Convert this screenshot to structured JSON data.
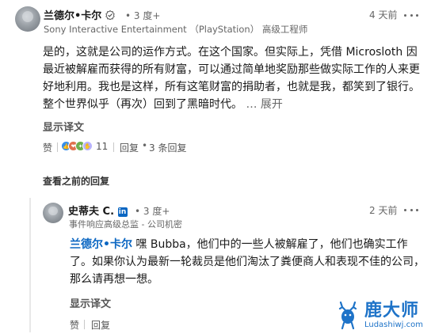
{
  "comment1": {
    "author": "兰德尔•卡尔",
    "degree": "• 3 度+",
    "headline": "Sony Interactive Entertainment （PlayStation） 高级工程师",
    "time": "4 天前",
    "text": "是的，这就是公司的运作方式。在这个国家。但实际上，凭借 Microsloth 因最近被解雇而获得的所有财富，可以通过简单地奖励那些做实际工作的人来更好地利用。我也是这样，所有这笔财富的捐助者，也就是我，都笑到了银行。整个世界似乎（再次）回到了黑暗时代。",
    "ellipsis": "…",
    "expand": "展开",
    "translate": "显示译文",
    "like": "赞",
    "reaction_count": "11",
    "reply": "回复",
    "reply_count": "3 条回复",
    "reaction_icons": [
      "like-icon",
      "love-icon",
      "celebrate-icon",
      "support-icon"
    ]
  },
  "load_previous": "查看之前的回复",
  "comment2": {
    "author": "史蒂夫 C.",
    "degree": "• 3 度+",
    "headline": "事件响应高级总监 - 公司机密",
    "time": "2 天前",
    "mention": "兰德尔•卡尔",
    "text": " 嘿 Bubba，他们中的一些人被解雇了，他们也确实工作了。如果你认为最新一轮裁员是他们淘汰了粪便商人和表现不佳的公司，那么请再想一想。",
    "translate": "显示译文",
    "like": "赞",
    "reply": "回复"
  },
  "watermark": {
    "brand": "鹿大师",
    "url": "Ludashiwj.com"
  },
  "colors": {
    "accent": "#0a66c2",
    "watermark": "#1e73c8"
  }
}
